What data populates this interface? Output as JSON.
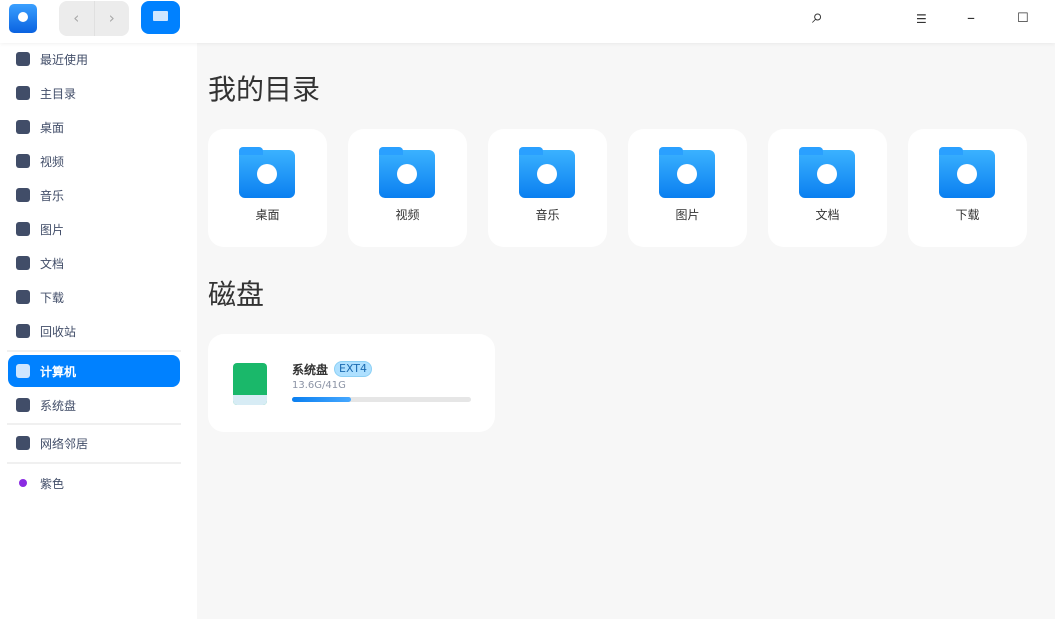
{
  "toolbar": {
    "back": "‹",
    "forward": "›",
    "search": "⌕",
    "menu": "☰",
    "minimize": "–",
    "maximize": "☐"
  },
  "sidebar": {
    "items": [
      {
        "label": "最近使用",
        "icon": "clock-icon"
      },
      {
        "label": "主目录",
        "icon": "home-icon"
      },
      {
        "label": "桌面",
        "icon": "desktop-icon"
      },
      {
        "label": "视频",
        "icon": "video-icon"
      },
      {
        "label": "音乐",
        "icon": "music-icon"
      },
      {
        "label": "图片",
        "icon": "picture-icon"
      },
      {
        "label": "文档",
        "icon": "document-icon"
      },
      {
        "label": "下载",
        "icon": "download-icon"
      },
      {
        "label": "回收站",
        "icon": "trash-icon"
      },
      {
        "label": "计算机",
        "icon": "computer-icon"
      },
      {
        "label": "系统盘",
        "icon": "disk-icon"
      },
      {
        "label": "网络邻居",
        "icon": "network-icon"
      },
      {
        "label": "紫色",
        "icon": "tag-icon",
        "color": "#8a2be2"
      }
    ]
  },
  "main": {
    "section1": "我的目录",
    "folders": [
      "桌面",
      "视频",
      "音乐",
      "图片",
      "文档",
      "下载"
    ],
    "section2": "磁盘",
    "disk": {
      "name": "系统盘",
      "fs": "EXT4",
      "size": "13.6G/41G",
      "used_fraction": 0.33
    }
  }
}
